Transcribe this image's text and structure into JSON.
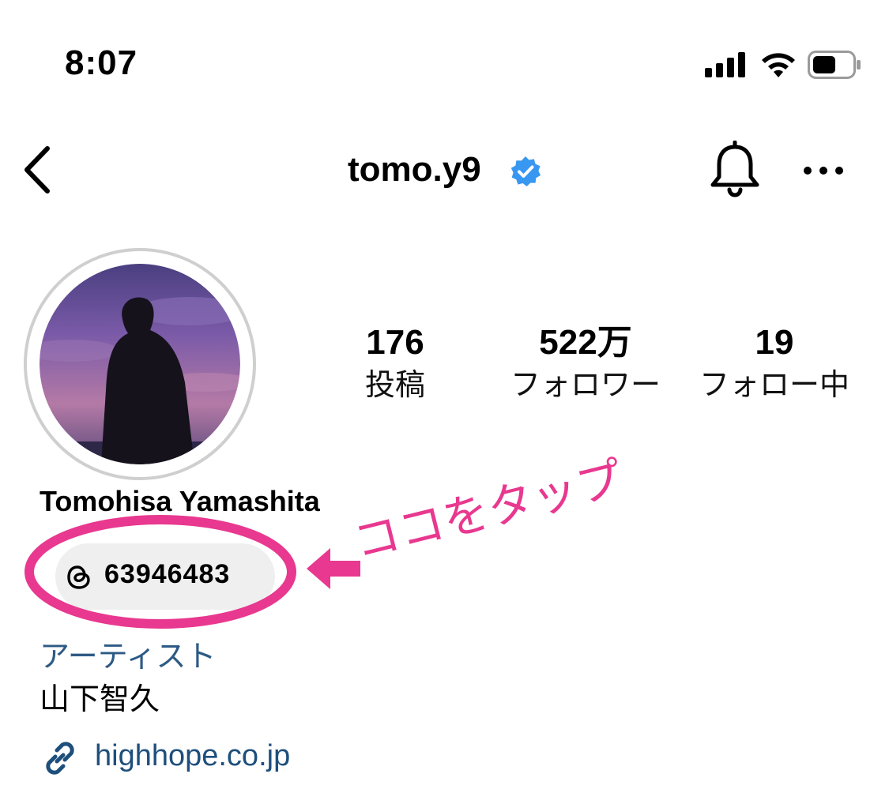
{
  "status_bar": {
    "time": "8:07"
  },
  "header": {
    "username": "tomo.y9"
  },
  "stats": [
    {
      "value": "176",
      "label": "投稿"
    },
    {
      "value": "522万",
      "label": "フォロワー"
    },
    {
      "value": "19",
      "label": "フォロー中"
    }
  ],
  "profile": {
    "full_name": "Tomohisa Yamashita",
    "threads_badge": "63946483",
    "category": "アーティスト",
    "bio": "山下智久",
    "link": "highhope.co.jp"
  },
  "annotation": {
    "text": "ココをタップ",
    "color": "#e8388f"
  },
  "colors": {
    "accent_pink": "#e8388f",
    "verified_blue": "#3897f0",
    "link_blue": "#1e4f7c"
  },
  "icons": [
    "signal-icon",
    "wifi-icon",
    "battery-icon",
    "back-chevron-icon",
    "verified-badge-icon",
    "bell-icon",
    "more-icon",
    "threads-icon",
    "link-icon",
    "arrow-icon"
  ]
}
